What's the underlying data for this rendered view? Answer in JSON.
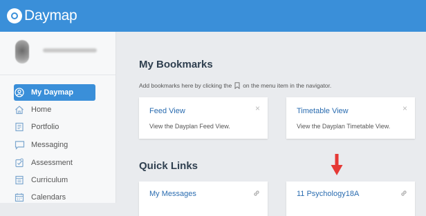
{
  "app": {
    "brand": "Daymap"
  },
  "colors": {
    "accent": "#3a8fd9",
    "link": "#2a6cb0",
    "arrow": "#e53935"
  },
  "sidebar": {
    "items": [
      {
        "label": "My Daymap",
        "icon": "user-circle-icon",
        "active": true
      },
      {
        "label": "Home",
        "icon": "home-icon"
      },
      {
        "label": "Portfolio",
        "icon": "portfolio-icon"
      },
      {
        "label": "Messaging",
        "icon": "message-icon"
      },
      {
        "label": "Assessment",
        "icon": "assessment-icon"
      },
      {
        "label": "Curriculum",
        "icon": "curriculum-icon"
      },
      {
        "label": "Calendars",
        "icon": "calendar-icon"
      }
    ]
  },
  "bookmarks": {
    "title": "My Bookmarks",
    "hint_before": "Add bookmarks here by clicking the",
    "hint_after": "on the menu item in the navigator.",
    "cards": [
      {
        "title": "Feed View",
        "description": "View the Dayplan Feed View.",
        "close": "×"
      },
      {
        "title": "Timetable View",
        "description": "View the Dayplan Timetable View.",
        "close": "×"
      }
    ]
  },
  "quick_links": {
    "title": "Quick Links",
    "cards": [
      {
        "title": "My Messages",
        "icon": "link-icon"
      },
      {
        "title": "11 Psychology18A",
        "icon": "link-icon"
      }
    ]
  }
}
